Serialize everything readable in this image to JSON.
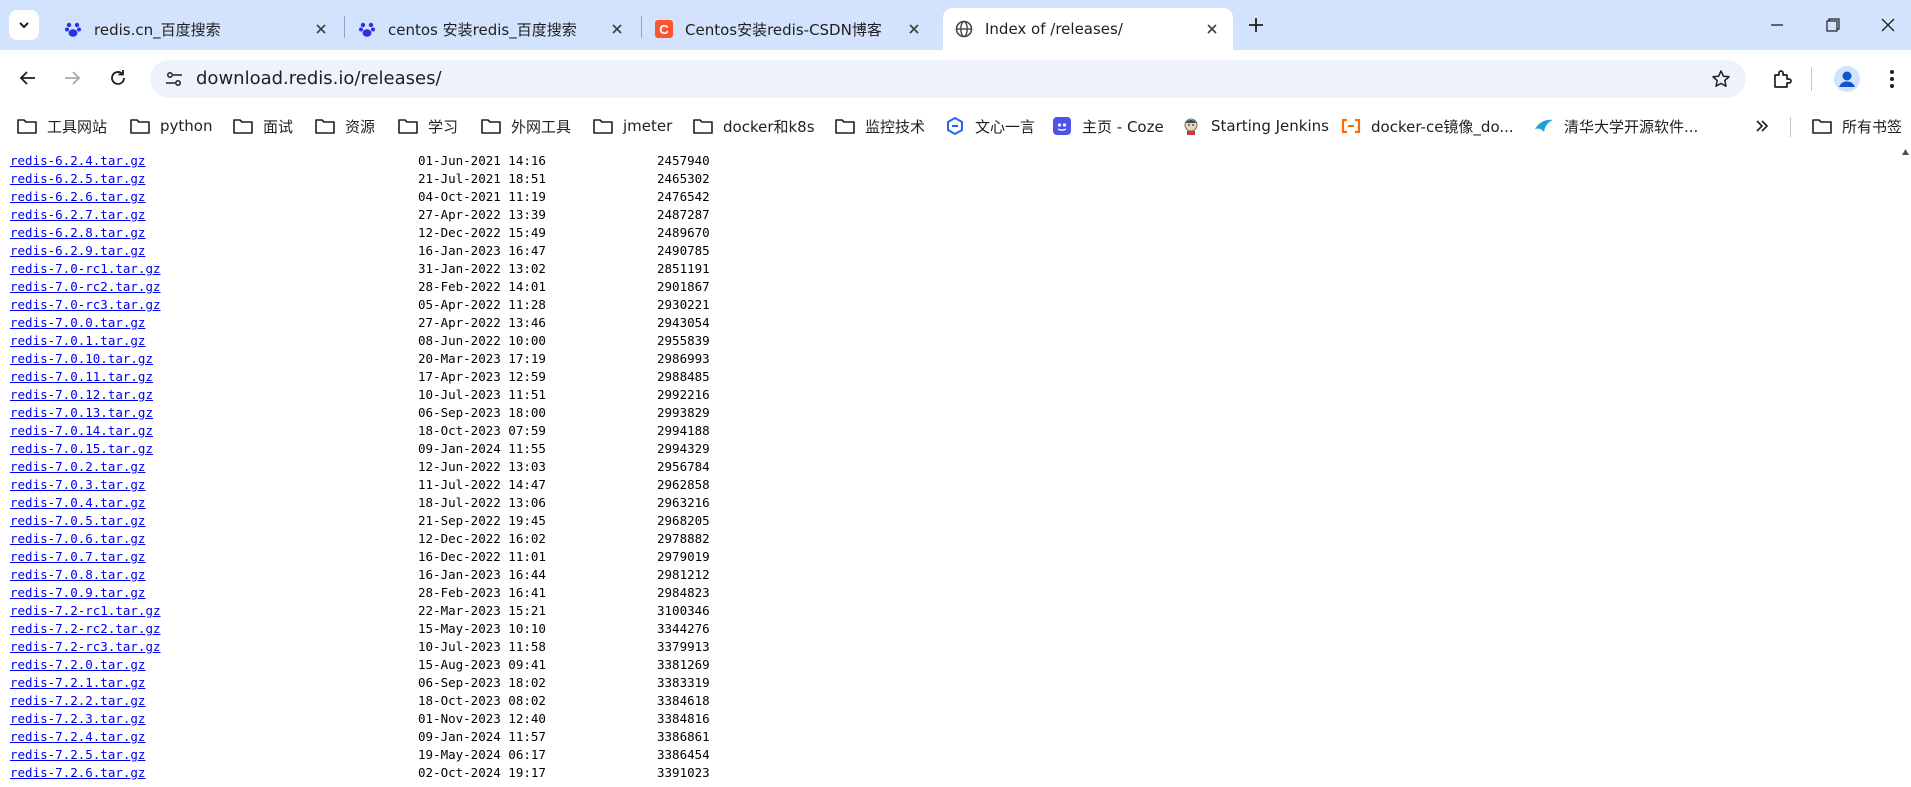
{
  "tabs": [
    {
      "title": "redis.cn_百度搜索",
      "icon": "baidu-paw-icon",
      "active": false
    },
    {
      "title": "centos 安装redis_百度搜索",
      "icon": "baidu-paw-icon",
      "active": false
    },
    {
      "title": "Centos安装redis-CSDN博客",
      "icon": "csdn-c-icon",
      "active": false
    },
    {
      "title": "Index of /releases/",
      "icon": "globe-icon",
      "active": true
    }
  ],
  "address_bar": {
    "url": "download.redis.io/releases/"
  },
  "bookmarks": [
    {
      "label": "工具网站",
      "icon": "folder-icon"
    },
    {
      "label": "python",
      "icon": "folder-icon"
    },
    {
      "label": "面试",
      "icon": "folder-icon"
    },
    {
      "label": "资源",
      "icon": "folder-icon"
    },
    {
      "label": "学习",
      "icon": "folder-icon"
    },
    {
      "label": "外网工具",
      "icon": "folder-icon"
    },
    {
      "label": "jmeter",
      "icon": "folder-icon"
    },
    {
      "label": "docker和k8s",
      "icon": "folder-icon"
    },
    {
      "label": "监控技术",
      "icon": "folder-icon"
    },
    {
      "label": "文心一言",
      "icon": "wenxin-icon"
    },
    {
      "label": "主页 - Coze",
      "icon": "coze-icon"
    },
    {
      "label": "Starting Jenkins",
      "icon": "jenkins-icon"
    },
    {
      "label": "docker-ce镜像_do...",
      "icon": "aliyun-icon"
    },
    {
      "label": "清华大学开源软件...",
      "icon": "tsinghua-icon"
    }
  ],
  "all_bookmarks_label": "所有书签",
  "colors": {
    "tabstrip": "#d3e3fd",
    "link": "#0000ee",
    "omnibox": "#eef3fb"
  },
  "listing": [
    {
      "name": "redis-6.2.4.tar.gz",
      "date": "01-Jun-2021 14:16",
      "size": "2457940"
    },
    {
      "name": "redis-6.2.5.tar.gz",
      "date": "21-Jul-2021 18:51",
      "size": "2465302"
    },
    {
      "name": "redis-6.2.6.tar.gz",
      "date": "04-Oct-2021 11:19",
      "size": "2476542"
    },
    {
      "name": "redis-6.2.7.tar.gz",
      "date": "27-Apr-2022 13:39",
      "size": "2487287"
    },
    {
      "name": "redis-6.2.8.tar.gz",
      "date": "12-Dec-2022 15:49",
      "size": "2489670"
    },
    {
      "name": "redis-6.2.9.tar.gz",
      "date": "16-Jan-2023 16:47",
      "size": "2490785"
    },
    {
      "name": "redis-7.0-rc1.tar.gz",
      "date": "31-Jan-2022 13:02",
      "size": "2851191"
    },
    {
      "name": "redis-7.0-rc2.tar.gz",
      "date": "28-Feb-2022 14:01",
      "size": "2901867"
    },
    {
      "name": "redis-7.0-rc3.tar.gz",
      "date": "05-Apr-2022 11:28",
      "size": "2930221"
    },
    {
      "name": "redis-7.0.0.tar.gz",
      "date": "27-Apr-2022 13:46",
      "size": "2943054"
    },
    {
      "name": "redis-7.0.1.tar.gz",
      "date": "08-Jun-2022 10:00",
      "size": "2955839"
    },
    {
      "name": "redis-7.0.10.tar.gz",
      "date": "20-Mar-2023 17:19",
      "size": "2986993"
    },
    {
      "name": "redis-7.0.11.tar.gz",
      "date": "17-Apr-2023 12:59",
      "size": "2988485"
    },
    {
      "name": "redis-7.0.12.tar.gz",
      "date": "10-Jul-2023 11:51",
      "size": "2992216"
    },
    {
      "name": "redis-7.0.13.tar.gz",
      "date": "06-Sep-2023 18:00",
      "size": "2993829"
    },
    {
      "name": "redis-7.0.14.tar.gz",
      "date": "18-Oct-2023 07:59",
      "size": "2994188"
    },
    {
      "name": "redis-7.0.15.tar.gz",
      "date": "09-Jan-2024 11:55",
      "size": "2994329"
    },
    {
      "name": "redis-7.0.2.tar.gz",
      "date": "12-Jun-2022 13:03",
      "size": "2956784"
    },
    {
      "name": "redis-7.0.3.tar.gz",
      "date": "11-Jul-2022 14:47",
      "size": "2962858"
    },
    {
      "name": "redis-7.0.4.tar.gz",
      "date": "18-Jul-2022 13:06",
      "size": "2963216"
    },
    {
      "name": "redis-7.0.5.tar.gz",
      "date": "21-Sep-2022 19:45",
      "size": "2968205"
    },
    {
      "name": "redis-7.0.6.tar.gz",
      "date": "12-Dec-2022 16:02",
      "size": "2978882"
    },
    {
      "name": "redis-7.0.7.tar.gz",
      "date": "16-Dec-2022 11:01",
      "size": "2979019"
    },
    {
      "name": "redis-7.0.8.tar.gz",
      "date": "16-Jan-2023 16:44",
      "size": "2981212"
    },
    {
      "name": "redis-7.0.9.tar.gz",
      "date": "28-Feb-2023 16:41",
      "size": "2984823"
    },
    {
      "name": "redis-7.2-rc1.tar.gz",
      "date": "22-Mar-2023 15:21",
      "size": "3100346"
    },
    {
      "name": "redis-7.2-rc2.tar.gz",
      "date": "15-May-2023 10:10",
      "size": "3344276"
    },
    {
      "name": "redis-7.2-rc3.tar.gz",
      "date": "10-Jul-2023 11:58",
      "size": "3379913"
    },
    {
      "name": "redis-7.2.0.tar.gz",
      "date": "15-Aug-2023 09:41",
      "size": "3381269"
    },
    {
      "name": "redis-7.2.1.tar.gz",
      "date": "06-Sep-2023 18:02",
      "size": "3383319"
    },
    {
      "name": "redis-7.2.2.tar.gz",
      "date": "18-Oct-2023 08:02",
      "size": "3384618"
    },
    {
      "name": "redis-7.2.3.tar.gz",
      "date": "01-Nov-2023 12:40",
      "size": "3384816"
    },
    {
      "name": "redis-7.2.4.tar.gz",
      "date": "09-Jan-2024 11:57",
      "size": "3386861"
    },
    {
      "name": "redis-7.2.5.tar.gz",
      "date": "19-May-2024 06:17",
      "size": "3386454"
    },
    {
      "name": "redis-7.2.6.tar.gz",
      "date": "02-Oct-2024 19:17",
      "size": "3391023"
    }
  ]
}
